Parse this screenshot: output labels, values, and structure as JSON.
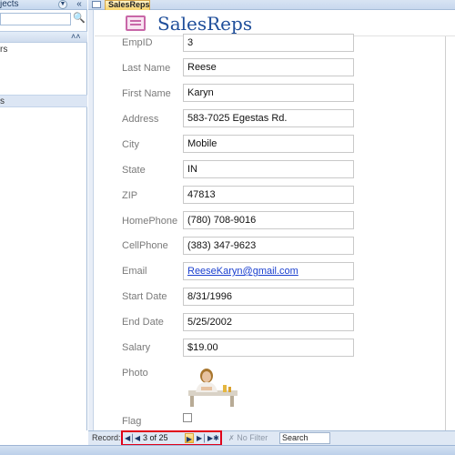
{
  "nav_pane": {
    "title": "jects",
    "items": [
      "rs",
      "s"
    ]
  },
  "tab": {
    "label": "SalesReps"
  },
  "form": {
    "title": "SalesReps",
    "fields": [
      {
        "label": "EmpID",
        "value": "3"
      },
      {
        "label": "Last Name",
        "value": "Reese"
      },
      {
        "label": "First Name",
        "value": "Karyn"
      },
      {
        "label": "Address",
        "value": "583-7025 Egestas Rd."
      },
      {
        "label": "City",
        "value": "Mobile"
      },
      {
        "label": "State",
        "value": "IN"
      },
      {
        "label": "ZIP",
        "value": "47813"
      },
      {
        "label": "HomePhone",
        "value": "(780) 708-9016"
      },
      {
        "label": "CellPhone",
        "value": "(383) 347-9623"
      },
      {
        "label": "Email",
        "value": "ReeseKaryn@gmail.com"
      },
      {
        "label": "Start Date",
        "value": "8/31/1996"
      },
      {
        "label": "End Date",
        "value": "5/25/2002"
      },
      {
        "label": "Salary",
        "value": "$19.00"
      }
    ],
    "photo_label": "Photo",
    "flag_label": "Flag",
    "flag_checked": false
  },
  "record_nav": {
    "label": "Record:",
    "current": "3 of 25",
    "first_icon": "first-record-icon",
    "prev_icon": "previous-record-icon",
    "next_icon": "next-record-icon",
    "last_icon": "last-record-icon",
    "new_icon": "new-record-icon",
    "filter_label": "No Filter",
    "search_label": "Search"
  },
  "colors": {
    "title": "#1f4e9a",
    "label": "#7a7a7a",
    "highlight_box": "#e0001a",
    "tab_active": "#f8d46b"
  }
}
